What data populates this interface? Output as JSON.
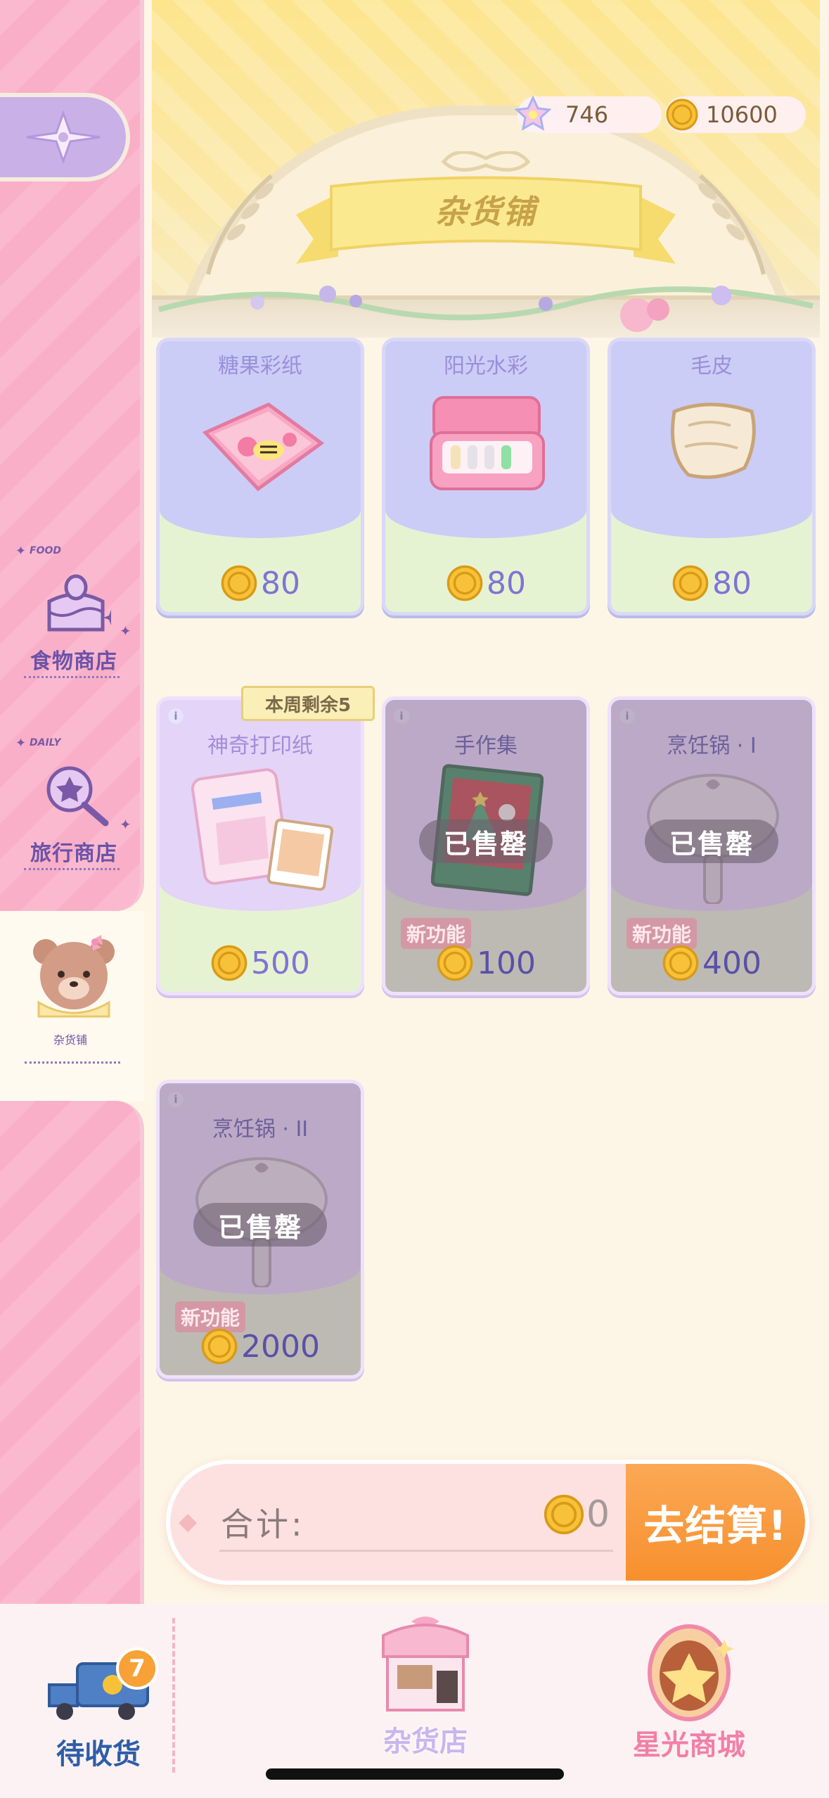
{
  "header": {
    "title": "杂货铺",
    "currency": [
      {
        "name": "star-gem",
        "value": "746"
      },
      {
        "name": "gold-coin",
        "value": "10600"
      }
    ]
  },
  "sidebar": {
    "tabs": [
      {
        "tag": "FOOD",
        "label": "食物商店"
      },
      {
        "tag": "DAILY",
        "label": "旅行商店"
      },
      {
        "tag": "",
        "label": "杂货铺"
      }
    ],
    "active": "杂货铺"
  },
  "shop": {
    "items_row1": [
      {
        "name": "糖果彩纸",
        "price": "80"
      },
      {
        "name": "阳光水彩",
        "price": "80"
      },
      {
        "name": "毛皮",
        "price": "80"
      }
    ],
    "items_row2": [
      {
        "name": "神奇打印纸",
        "price": "500",
        "weekly_tag": "本周剩余5"
      },
      {
        "name": "手作集",
        "price": "100",
        "status": "已售罄",
        "feature": "新功能"
      },
      {
        "name": "烹饪锅 · I",
        "price": "400",
        "status": "已售罄",
        "feature": "新功能"
      }
    ],
    "items_row3": [
      {
        "name": "烹饪锅 · II",
        "price": "2000",
        "status": "已售罄",
        "feature": "新功能"
      }
    ],
    "info_glyph": "i"
  },
  "checkout": {
    "total_label": "合计:",
    "total_value": "0",
    "button_label": "去结算!"
  },
  "bottom_nav": {
    "items": [
      {
        "label": "待收货",
        "badge": "7"
      },
      {
        "label": "杂货店"
      },
      {
        "label": "星光商城"
      }
    ]
  },
  "colors": {
    "accent_orange": "#f7902e",
    "sidebar_pink": "#fbb9cf",
    "card_lavender": "#c7c8f5",
    "text_purple": "#6b53a8"
  }
}
